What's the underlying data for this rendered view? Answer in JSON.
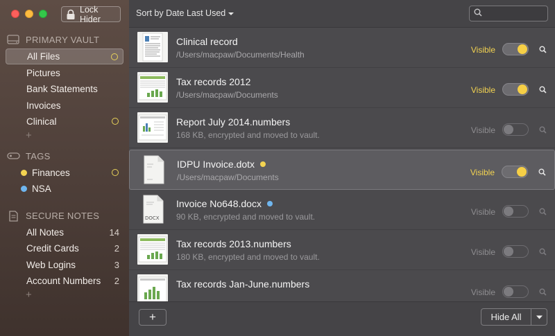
{
  "window": {
    "lock_button_label": "Lock Hider"
  },
  "sidebar": {
    "vault_header": "PRIMARY VAULT",
    "vault_items": [
      {
        "label": "All Files",
        "marker": true
      },
      {
        "label": "Pictures",
        "marker": false
      },
      {
        "label": "Bank Statements",
        "marker": false
      },
      {
        "label": "Invoices",
        "marker": false
      },
      {
        "label": "Clinical",
        "marker": true
      }
    ],
    "tags_header": "TAGS",
    "tags": [
      {
        "label": "Finances",
        "color": "#f3d351",
        "marker": true
      },
      {
        "label": "NSA",
        "color": "#6fb6ef",
        "marker": false
      }
    ],
    "notes_header": "SECURE NOTES",
    "notes": [
      {
        "label": "All Notes",
        "count": "14"
      },
      {
        "label": "Credit Cards",
        "count": "2"
      },
      {
        "label": "Web Logins",
        "count": "3"
      },
      {
        "label": "Account Numbers",
        "count": "2"
      }
    ],
    "add_symbol": "+"
  },
  "toolbar": {
    "sort_label": "Sort by Date Last Used",
    "search_placeholder": ""
  },
  "files": [
    {
      "name": "Clinical record",
      "sub": "/Users/macpaw/Documents/Health",
      "visible_label": "Visible",
      "visible": true,
      "thumb": "document"
    },
    {
      "name": "Tax records 2012",
      "sub": "/Users/macpaw/Documents",
      "visible_label": "Visible",
      "visible": true,
      "thumb": "spreadsheet"
    },
    {
      "name": "Report July 2014.numbers",
      "sub": "168 KB, encrypted and moved to vault.",
      "visible_label": "Visible",
      "visible": false,
      "thumb": "chart"
    },
    {
      "name": "IDPU Invoice.dotx",
      "sub": "/Users/macpaw/Documents",
      "visible_label": "Visible",
      "visible": true,
      "thumb": "blank-doc",
      "tag_color": "#f3d351"
    },
    {
      "name": "Invoice No648.docx",
      "sub": "90 KB, encrypted and moved to vault.",
      "visible_label": "Visible",
      "visible": false,
      "thumb": "docx",
      "tag_color": "#6fb6ef"
    },
    {
      "name": "Tax records 2013.numbers",
      "sub": "180 KB, encrypted and moved to vault.",
      "visible_label": "Visible",
      "visible": false,
      "thumb": "spreadsheet"
    },
    {
      "name": "Tax records Jan-June.numbers",
      "sub": "",
      "visible_label": "Visible",
      "visible": false,
      "thumb": "chart"
    }
  ],
  "docx_thumb_label": "DOCX",
  "bottom": {
    "add_symbol": "+",
    "hide_all_label": "Hide All"
  },
  "colors": {
    "accent_yellow": "#f3d351",
    "toggle_knob_on": "#f6cf46",
    "tag_blue": "#6fb6ef"
  }
}
